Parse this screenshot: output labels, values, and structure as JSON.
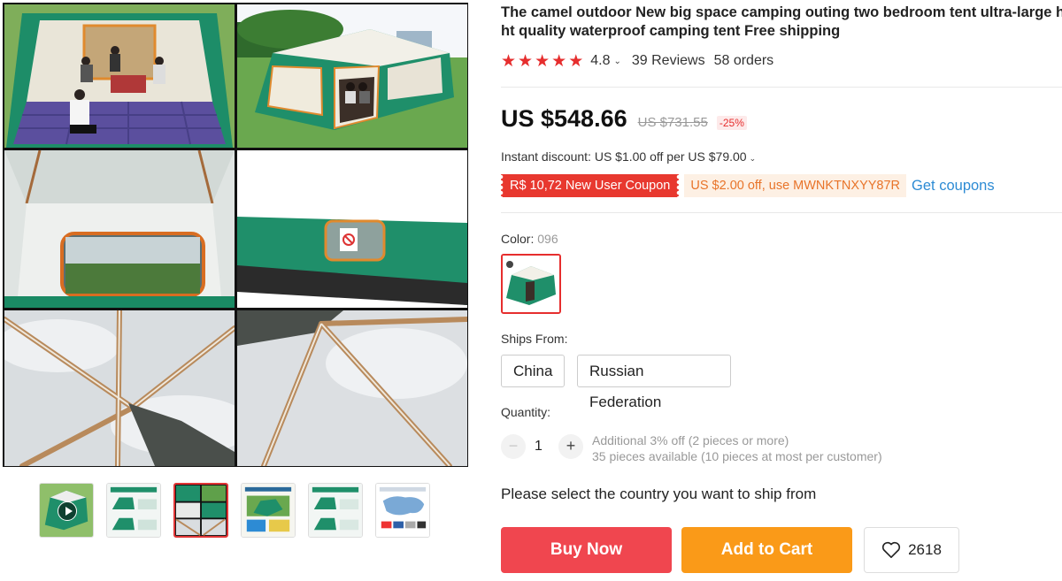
{
  "product": {
    "title_line1": "The camel outdoor New big space camping outing two bedroom tent ultra-large hig",
    "title_line2": "ht quality waterproof camping tent Free shipping",
    "rating": "4.8",
    "rating_stars": 5,
    "reviews": "39 Reviews",
    "orders": "58 orders"
  },
  "pricing": {
    "price": "US $548.66",
    "original_price": "US $731.55",
    "discount": "-25%",
    "instant_discount": "Instant discount: US $1.00 off per US $79.00"
  },
  "coupons": {
    "new_user": "R$ 10,72 New User Coupon",
    "code_offer": "US $2.00 off, use MWNKTNXYY87R",
    "get_coupons": "Get coupons"
  },
  "color": {
    "label": "Color:",
    "selected": "096"
  },
  "shipping": {
    "label": "Ships From:",
    "options": [
      "China",
      "Russian Federation"
    ]
  },
  "quantity": {
    "label": "Quantity:",
    "minus": "−",
    "value": "1",
    "plus": "+",
    "discount_note": "Additional 3% off (2 pieces or more)",
    "availability": "35 pieces available (10 pieces at most per customer)"
  },
  "notice": "Please select the country you want to ship from",
  "actions": {
    "buy_now": "Buy Now",
    "add_to_cart": "Add to Cart",
    "wishlist_count": "2618"
  },
  "colors": {
    "accent_red": "#e62e2e",
    "buy_now": "#f0464f",
    "add_to_cart": "#fa9a18",
    "link_blue": "#2d8bd4",
    "tent_green": "#1f8f6a"
  },
  "icons": {
    "star": "star-icon",
    "chevron": "chevron-down-icon",
    "heart": "heart-icon",
    "play": "play-icon"
  }
}
